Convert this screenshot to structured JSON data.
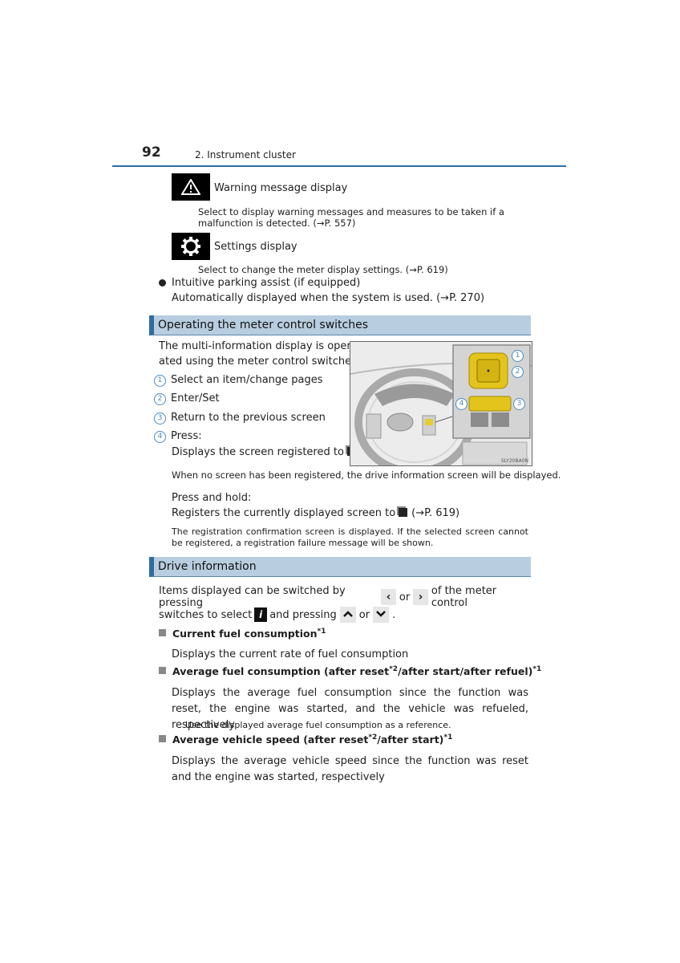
{
  "header": {
    "page_number": "92",
    "chapter": "2. Instrument cluster"
  },
  "top_items": [
    {
      "icon": "warning-triangle-icon",
      "title": "Warning message display",
      "description": "Select to display warning messages and measures to be taken if a malfunction is detected. (→P. 557)"
    },
    {
      "icon": "gear-icon",
      "title": "Settings display",
      "description": "Select to change the meter display settings. (→P. 619)"
    }
  ],
  "parking_assist": {
    "title": "Intuitive parking assist (if equipped)",
    "description": "Automatically displayed when the system is used. (→P. 270)"
  },
  "section_meter": {
    "heading": "Operating the meter control switches",
    "intro": "The multi-information display is operated using the meter control switches.",
    "intro_line1": "The multi-information display is oper-",
    "intro_line2": "ated using the meter control switches.",
    "items": [
      {
        "num": "1",
        "label": "Select an item/change pages"
      },
      {
        "num": "2",
        "label": "Enter/Set"
      },
      {
        "num": "3",
        "label": "Return to the previous screen"
      },
      {
        "num": "4",
        "label": "Press:"
      }
    ],
    "press_desc": "Displays the screen registered to",
    "press_note": "When no screen has been registered, the drive information screen will be displayed.",
    "hold_label": "Press and hold:",
    "hold_desc": "Registers the currently displayed screen to",
    "hold_ref": "(→P. 619)",
    "hold_note": "The registration confirmation screen is displayed. If the selected screen cannot be registered, a registration failure message will be shown.",
    "figure_code": "SLY20BA0N",
    "figure_callouts": [
      "1",
      "2",
      "3",
      "4"
    ]
  },
  "section_drive": {
    "heading": "Drive information",
    "intro_part1": "Items displayed can be switched by pressing",
    "or1": "or",
    "intro_part2": "of the meter control",
    "intro_part3": "switches to select",
    "intro_part4": "and pressing",
    "or2": "or",
    "period": ".",
    "keys": {
      "left": "‹",
      "right": "›",
      "up": "˄",
      "down": "˅",
      "info": "i"
    },
    "items": [
      {
        "title": "Current fuel consumption",
        "title_sup": "*1",
        "description": "Displays the current rate of fuel consumption"
      },
      {
        "title_a": "Average fuel consumption (after reset",
        "sup_a": "*2",
        "title_b": "/after start/after refuel)",
        "sup_b": "*1",
        "description": "Displays the average fuel consumption since the function was reset, the engine was started, and the vehicle was refueled, respectively",
        "note": "Use the displayed average fuel consumption as a reference."
      },
      {
        "title_a": "Average vehicle speed (after reset",
        "sup_a": "*2",
        "title_b": "/after start)",
        "sup_b": "*1",
        "description": "Displays the average vehicle speed since the function was reset and the engine was started, respectively"
      }
    ]
  }
}
